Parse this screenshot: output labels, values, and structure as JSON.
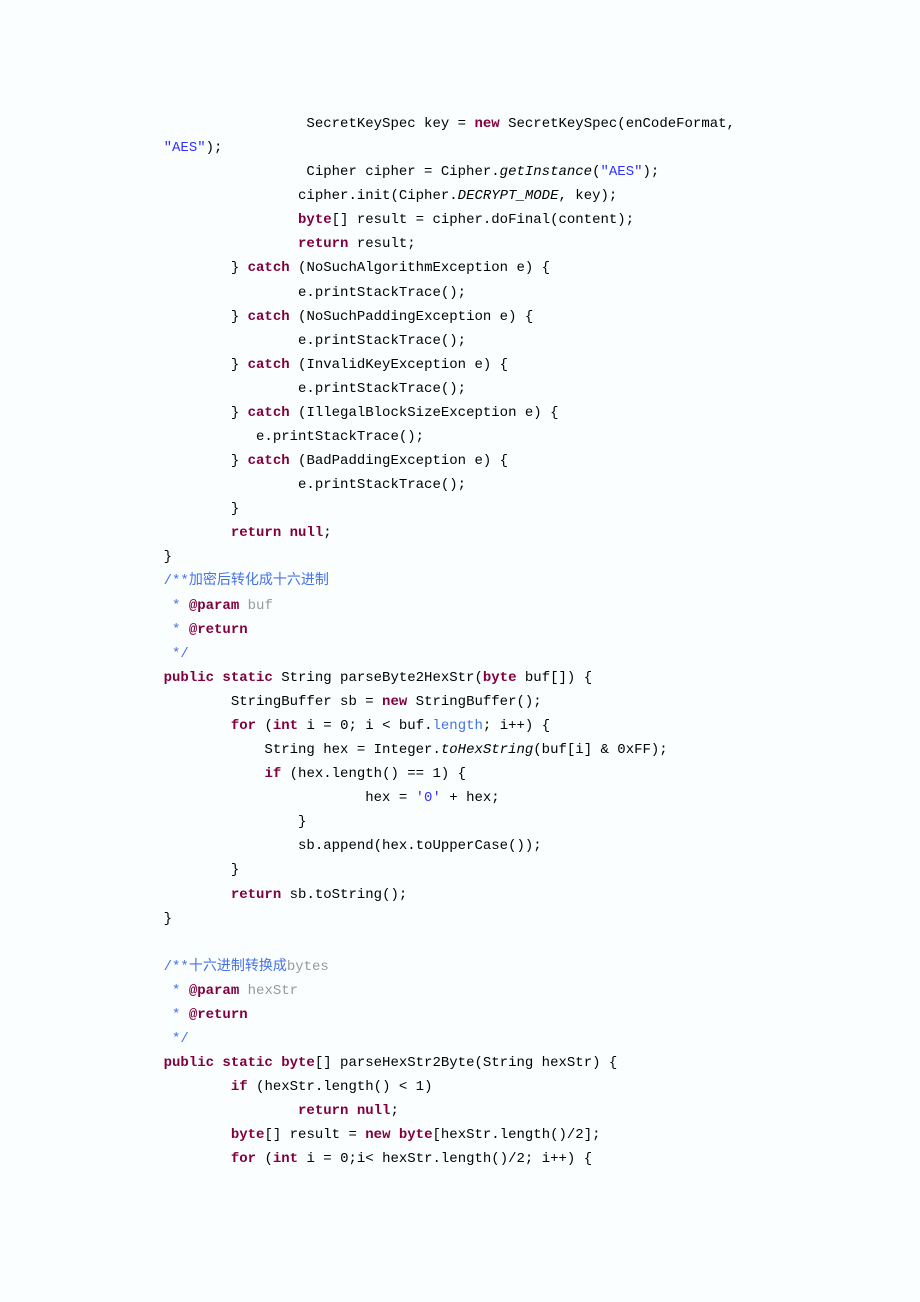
{
  "lines": [
    [
      [
        "pl",
        "                 SecretKeySpec key = "
      ],
      [
        "kw",
        "new"
      ],
      [
        "pl",
        " SecretKeySpec(enCodeFormat, "
      ]
    ],
    [
      [
        "str",
        "\"AES\""
      ],
      [
        "pl",
        ");"
      ]
    ],
    [
      [
        "pl",
        "                 Cipher cipher = Cipher."
      ],
      [
        "it",
        "getInstance"
      ],
      [
        "pl",
        "("
      ],
      [
        "str",
        "\"AES\""
      ],
      [
        "pl",
        ");"
      ]
    ],
    [
      [
        "pl",
        "                cipher.init(Cipher."
      ],
      [
        "it",
        "DECRYPT_MODE"
      ],
      [
        "pl",
        ", key);"
      ]
    ],
    [
      [
        "pl",
        "                "
      ],
      [
        "kw",
        "byte"
      ],
      [
        "pl",
        "[] result = cipher.doFinal(content);"
      ]
    ],
    [
      [
        "pl",
        "                "
      ],
      [
        "kw",
        "return"
      ],
      [
        "pl",
        " result;"
      ]
    ],
    [
      [
        "pl",
        "        } "
      ],
      [
        "kw",
        "catch"
      ],
      [
        "pl",
        " (NoSuchAlgorithmException e) {"
      ]
    ],
    [
      [
        "pl",
        "                e.printStackTrace();"
      ]
    ],
    [
      [
        "pl",
        "        } "
      ],
      [
        "kw",
        "catch"
      ],
      [
        "pl",
        " (NoSuchPaddingException e) {"
      ]
    ],
    [
      [
        "pl",
        "                e.printStackTrace();"
      ]
    ],
    [
      [
        "pl",
        "        } "
      ],
      [
        "kw",
        "catch"
      ],
      [
        "pl",
        " (InvalidKeyException e) {"
      ]
    ],
    [
      [
        "pl",
        "                e.printStackTrace();"
      ]
    ],
    [
      [
        "pl",
        "        } "
      ],
      [
        "kw",
        "catch"
      ],
      [
        "pl",
        " (IllegalBlockSizeException e) {"
      ]
    ],
    [
      [
        "pl",
        "           e.printStackTrace();"
      ]
    ],
    [
      [
        "pl",
        "        } "
      ],
      [
        "kw",
        "catch"
      ],
      [
        "pl",
        " (BadPaddingException e) {"
      ]
    ],
    [
      [
        "pl",
        "                e.printStackTrace();"
      ]
    ],
    [
      [
        "pl",
        "        }"
      ]
    ],
    [
      [
        "pl",
        "        "
      ],
      [
        "kw",
        "return null"
      ],
      [
        "pl",
        ";"
      ]
    ],
    [
      [
        "pl",
        "}"
      ]
    ],
    [
      [
        "cmt",
        "/**"
      ],
      [
        "cmt-cn",
        "加密后转化成十六进制"
      ]
    ],
    [
      [
        "cmt",
        " * "
      ],
      [
        "kw",
        "@param"
      ],
      [
        "cmt",
        " "
      ],
      [
        "pname",
        "buf"
      ]
    ],
    [
      [
        "cmt",
        " * "
      ],
      [
        "kw",
        "@return"
      ]
    ],
    [
      [
        "cmt",
        " */"
      ]
    ],
    [
      [
        "kw",
        "public static"
      ],
      [
        "pl",
        " String parseByte2HexStr("
      ],
      [
        "kw",
        "byte"
      ],
      [
        "pl",
        " buf[]) {"
      ]
    ],
    [
      [
        "pl",
        "        StringBuffer sb = "
      ],
      [
        "kw",
        "new"
      ],
      [
        "pl",
        " StringBuffer();"
      ]
    ],
    [
      [
        "pl",
        "        "
      ],
      [
        "kw",
        "for"
      ],
      [
        "pl",
        " ("
      ],
      [
        "kw",
        "int"
      ],
      [
        "pl",
        " i = 0; i < buf."
      ],
      [
        "cmt",
        "length"
      ],
      [
        "pl",
        "; i++) {"
      ]
    ],
    [
      [
        "pl",
        "            String hex = Integer."
      ],
      [
        "it",
        "toHexString"
      ],
      [
        "pl",
        "(buf[i] & 0xFF);"
      ]
    ],
    [
      [
        "pl",
        "            "
      ],
      [
        "kw",
        "if"
      ],
      [
        "pl",
        " (hex.length() == 1) {"
      ]
    ],
    [
      [
        "pl",
        "                        hex = "
      ],
      [
        "str",
        "'0'"
      ],
      [
        "pl",
        " + hex;"
      ]
    ],
    [
      [
        "pl",
        "                }"
      ]
    ],
    [
      [
        "pl",
        "                sb.append(hex.toUpperCase());"
      ]
    ],
    [
      [
        "pl",
        "        }"
      ]
    ],
    [
      [
        "pl",
        "        "
      ],
      [
        "kw",
        "return"
      ],
      [
        "pl",
        " sb.toString();"
      ]
    ],
    [
      [
        "pl",
        "}"
      ]
    ],
    [
      [
        "pl",
        ""
      ]
    ],
    [
      [
        "cmt",
        "/**"
      ],
      [
        "cmt-cn",
        "十六进制转换成"
      ],
      [
        "pname",
        "bytes"
      ]
    ],
    [
      [
        "cmt",
        " * "
      ],
      [
        "kw",
        "@param"
      ],
      [
        "cmt",
        " "
      ],
      [
        "pname",
        "hexStr"
      ]
    ],
    [
      [
        "cmt",
        " * "
      ],
      [
        "kw",
        "@return"
      ]
    ],
    [
      [
        "cmt",
        " */"
      ]
    ],
    [
      [
        "kw",
        "public static byte"
      ],
      [
        "pl",
        "[] parseHexStr2Byte(String hexStr) {"
      ]
    ],
    [
      [
        "pl",
        "        "
      ],
      [
        "kw",
        "if"
      ],
      [
        "pl",
        " (hexStr.length() < 1)"
      ]
    ],
    [
      [
        "pl",
        "                "
      ],
      [
        "kw",
        "return null"
      ],
      [
        "pl",
        ";"
      ]
    ],
    [
      [
        "pl",
        "        "
      ],
      [
        "kw",
        "byte"
      ],
      [
        "pl",
        "[] result = "
      ],
      [
        "kw",
        "new byte"
      ],
      [
        "pl",
        "[hexStr.length()/2];"
      ]
    ],
    [
      [
        "pl",
        "        "
      ],
      [
        "kw",
        "for"
      ],
      [
        "pl",
        " ("
      ],
      [
        "kw",
        "int"
      ],
      [
        "pl",
        " i = 0;i< hexStr.length()/2; i++) {"
      ]
    ]
  ],
  "base_indent": "    "
}
